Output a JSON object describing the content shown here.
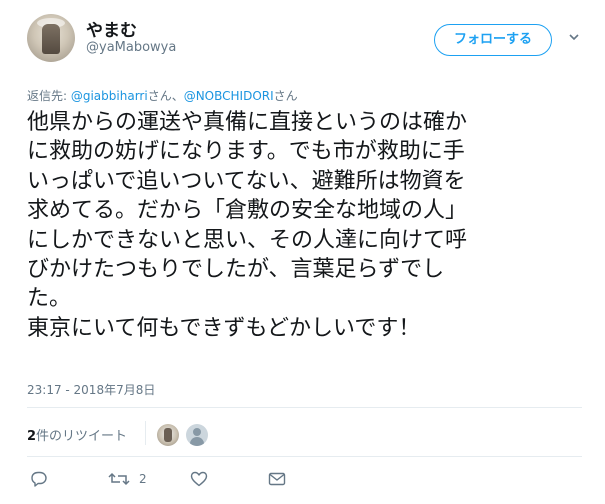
{
  "author": {
    "display_name": "やまむ",
    "handle": "@yaMabowya"
  },
  "follow_button": {
    "label": "フォローする"
  },
  "reply_to": {
    "prefix": "返信先: ",
    "mention1": "@giabbiharri",
    "sep1": "さん、",
    "mention2": "@NOBCHIDORI",
    "suffix": "さん"
  },
  "tweet": {
    "lines": [
      "他県からの運送や真備に直接というのは確か",
      "に救助の妨げになります。でも市が救助に手",
      "いっぱいで追いついてない、避難所は物資を",
      "求めてる。だから「倉敷の安全な地域の人」",
      "にしかできないと思い、その人達に向けて呼",
      "びかけたつもりでしたが、言葉足らずでし",
      "た。",
      "東京にいて何もできずもどかしいです！"
    ],
    "timestamp": "23:17 - 2018年7月8日"
  },
  "stats": {
    "retweet_count": "2",
    "retweet_label": "件のリツイート"
  },
  "actions": {
    "reply_icon": "reply-icon",
    "retweet_icon": "retweet-icon",
    "retweet_count": "2",
    "like_icon": "heart-icon",
    "dm_icon": "envelope-icon"
  },
  "colors": {
    "accent": "#1da1f2",
    "mention": "#1b95e0",
    "secondary_text": "#657786",
    "divider": "#e6ecf0"
  }
}
